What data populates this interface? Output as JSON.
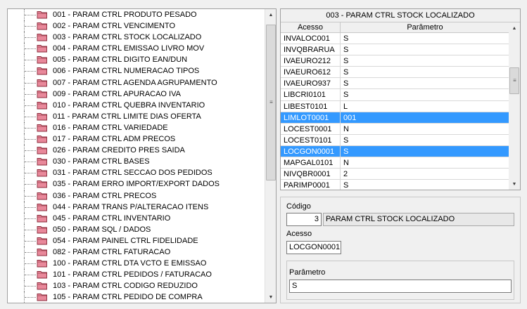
{
  "tree": {
    "items": [
      {
        "label": "001 - PARAM CTRL PRODUTO PESADO"
      },
      {
        "label": "002 - PARAM CTRL VENCIMENTO"
      },
      {
        "label": "003 - PARAM CTRL STOCK LOCALIZADO"
      },
      {
        "label": "004 - PARAM CTRL EMISSAO LIVRO MOV"
      },
      {
        "label": "005 - PARAM CTRL DIGITO EAN/DUN"
      },
      {
        "label": "006 - PARAM CTRL NUMERACAO TIPOS"
      },
      {
        "label": "007 - PARAM CTRL AGENDA AGRUPAMENTO"
      },
      {
        "label": "009 - PARAM CTRL APURACAO IVA"
      },
      {
        "label": "010 - PARAM CTRL QUEBRA INVENTARIO"
      },
      {
        "label": "011 - PARAM CTRL LIMITE DIAS OFERTA"
      },
      {
        "label": "016 - PARAM CTRL VARIEDADE"
      },
      {
        "label": "017 - PARAM CTRL ADM PRECOS"
      },
      {
        "label": "026 - PARAM CREDITO PRES SAIDA"
      },
      {
        "label": "030 - PARAM CTRL BASES"
      },
      {
        "label": "031 - PARAM CTRL SECCAO DOS PEDIDOS"
      },
      {
        "label": "035 - PARAM ERRO IMPORT/EXPORT DADOS"
      },
      {
        "label": "036 - PARAM CTRL PRECOS"
      },
      {
        "label": "044 - PARAM TRANS P/ALTERACAO ITENS"
      },
      {
        "label": "045 - PARAM CTRL INVENTARIO"
      },
      {
        "label": "050 - PARAM SQL / DADOS"
      },
      {
        "label": "054 - PARAM PAINEL CTRL FIDELIDADE"
      },
      {
        "label": "082 - PARAM CTRL FATURACAO"
      },
      {
        "label": "100 - PARAM CTRL DTA VCTO E EMISSAO"
      },
      {
        "label": "101 - PARAM CTRL PEDIDOS / FATURACAO"
      },
      {
        "label": "103 - PARAM CTRL CODIGO REDUZIDO"
      },
      {
        "label": "105 - PARAM CTRL PEDIDO DE COMPRA"
      }
    ]
  },
  "grid": {
    "title": "003 - PARAM CTRL STOCK LOCALIZADO",
    "columns": [
      "Acesso",
      "Parâmetro"
    ],
    "rows": [
      {
        "acesso": "INVALOC001",
        "parametro": "S",
        "selected": false
      },
      {
        "acesso": "INVQBRARUA",
        "parametro": "S",
        "selected": false
      },
      {
        "acesso": "IVAEURO212",
        "parametro": "S",
        "selected": false
      },
      {
        "acesso": "IVAEURO612",
        "parametro": "S",
        "selected": false
      },
      {
        "acesso": "IVAEURO937",
        "parametro": "S",
        "selected": false
      },
      {
        "acesso": "LIBCRI0101",
        "parametro": "S",
        "selected": false
      },
      {
        "acesso": "LIBEST0101",
        "parametro": "L",
        "selected": false
      },
      {
        "acesso": "LIMLOT0001",
        "parametro": "001",
        "selected": true
      },
      {
        "acesso": "LOCEST0001",
        "parametro": "N",
        "selected": false
      },
      {
        "acesso": "LOCEST0101",
        "parametro": "S",
        "selected": false
      },
      {
        "acesso": "LOCGON0001",
        "parametro": "S",
        "selected": true
      },
      {
        "acesso": "MAPGAL0101",
        "parametro": "N",
        "selected": false
      },
      {
        "acesso": "NIVQBR0001",
        "parametro": "2",
        "selected": false
      },
      {
        "acesso": "PARIMP0001",
        "parametro": "S",
        "selected": false
      }
    ]
  },
  "detail": {
    "codigo_label": "Código",
    "codigo_value": "3",
    "codigo_desc": "PARAM CTRL STOCK LOCALIZADO",
    "acesso_label": "Acesso",
    "acesso_value": "LOCGON0001",
    "parametro_label": "Parâmetro",
    "parametro_value": "S"
  },
  "colors": {
    "selection": "#3399ff",
    "folder": "#e07a8c"
  },
  "icons": {
    "tree_item": "folder-icon",
    "scroll_up": "scroll-up-arrow-icon",
    "scroll_down": "scroll-down-arrow-icon"
  }
}
